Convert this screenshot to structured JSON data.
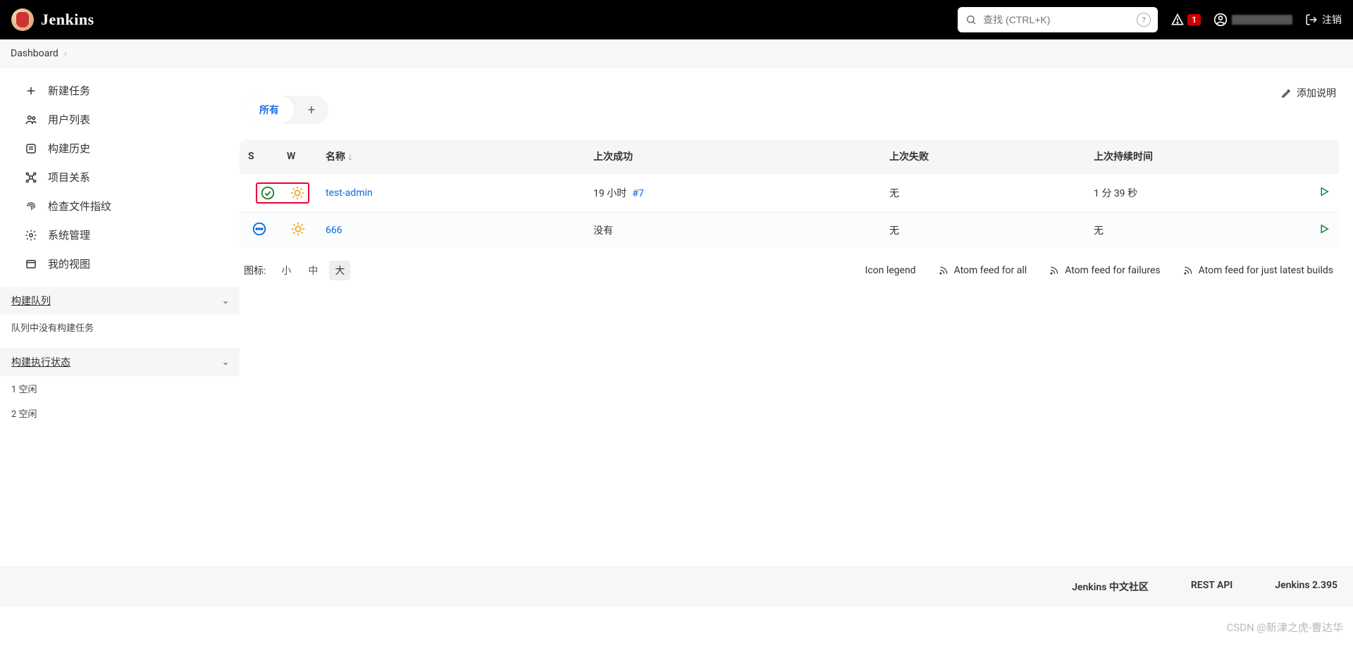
{
  "header": {
    "logo_text": "Jenkins",
    "search_placeholder": "查找 (CTRL+K)",
    "alert_count": "1",
    "logout": "注销"
  },
  "breadcrumb": {
    "dashboard": "Dashboard"
  },
  "sidebar": {
    "items": [
      {
        "label": "新建任务"
      },
      {
        "label": "用户列表"
      },
      {
        "label": "构建历史"
      },
      {
        "label": "项目关系"
      },
      {
        "label": "检查文件指纹"
      },
      {
        "label": "系统管理"
      },
      {
        "label": "我的视图"
      }
    ],
    "queue": {
      "title": "构建队列",
      "empty": "队列中没有构建任务"
    },
    "exec": {
      "title": "构建执行状态",
      "rows": [
        "1  空闲",
        "2  空闲"
      ]
    }
  },
  "main": {
    "add_description": "添加说明",
    "tabs": {
      "all": "所有",
      "plus": "+"
    },
    "columns": {
      "s": "S",
      "w": "W",
      "name": "名称",
      "sort_arrow": "↓",
      "last_success": "上次成功",
      "last_fail": "上次失败",
      "last_duration": "上次持续时间"
    },
    "rows": [
      {
        "name": "test-admin",
        "last_success_txt": "19 小时",
        "last_success_build": "#7",
        "last_fail": "无",
        "duration": "1 分 39 秒",
        "status": "success"
      },
      {
        "name": "666",
        "last_success_txt": "没有",
        "last_success_build": "",
        "last_fail": "无",
        "duration": "无",
        "status": "notbuilt"
      }
    ],
    "sizes": {
      "label": "图标:",
      "s": "小",
      "m": "中",
      "l": "大"
    },
    "feeds": {
      "legend": "Icon legend",
      "all": "Atom feed for all",
      "fail": "Atom feed for failures",
      "latest": "Atom feed for just latest builds"
    }
  },
  "footer": {
    "community": "Jenkins 中文社区",
    "rest": "REST API",
    "version": "Jenkins 2.395"
  },
  "watermark": "CSDN @新津之虎-曹达华"
}
